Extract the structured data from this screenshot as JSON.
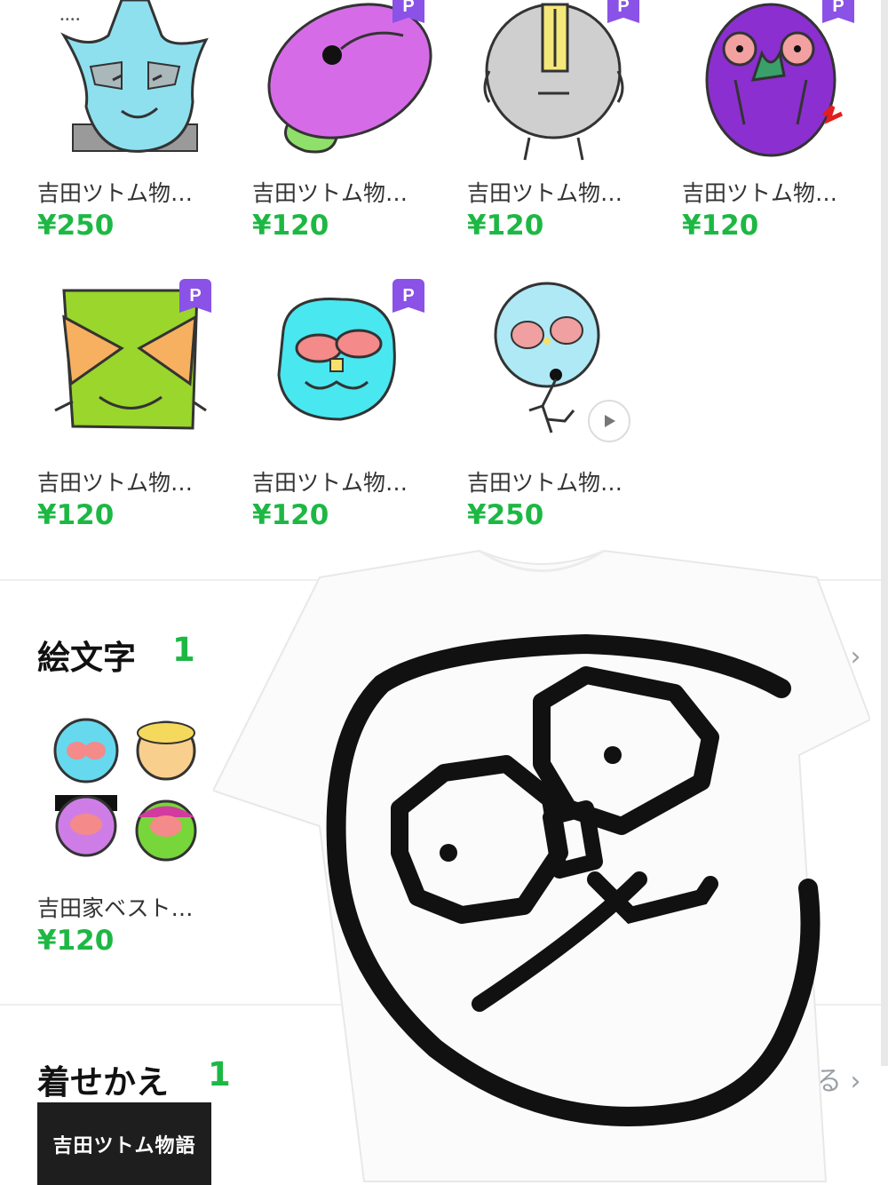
{
  "stickers": [
    {
      "title": "吉田ツトム物…",
      "price": "¥250",
      "premium": false,
      "icon": "sticker-blue-masked-face"
    },
    {
      "title": "吉田ツトム物…",
      "price": "¥120",
      "premium": true,
      "icon": "sticker-purple-bean"
    },
    {
      "title": "吉田ツトム物…",
      "price": "¥120",
      "premium": true,
      "icon": "sticker-grey-round-face"
    },
    {
      "title": "吉田ツトム物…",
      "price": "¥120",
      "premium": true,
      "icon": "sticker-purple-oval-face"
    },
    {
      "title": "吉田ツトム物…",
      "price": "¥120",
      "premium": true,
      "icon": "sticker-green-square-face"
    },
    {
      "title": "吉田ツトム物…",
      "price": "¥120",
      "premium": true,
      "icon": "sticker-cyan-face"
    },
    {
      "title": "吉田ツトム物…",
      "price": "¥250",
      "premium": false,
      "animated": true,
      "icon": "sticker-balloon-face"
    }
  ],
  "badge_label": "P",
  "emoji_section": {
    "title": "絵文字",
    "count": "1",
    "see_more": "る",
    "item": {
      "title": "吉田家ベスト…",
      "price": "¥120"
    }
  },
  "theme_section": {
    "title": "着せかえ",
    "count": "1",
    "see_more": "見る",
    "item": {
      "label": "吉田ツトム物語"
    }
  },
  "colors": {
    "price_green": "#1db844",
    "premium_purple": "#8a52e6",
    "divider": "#eeeeee"
  }
}
